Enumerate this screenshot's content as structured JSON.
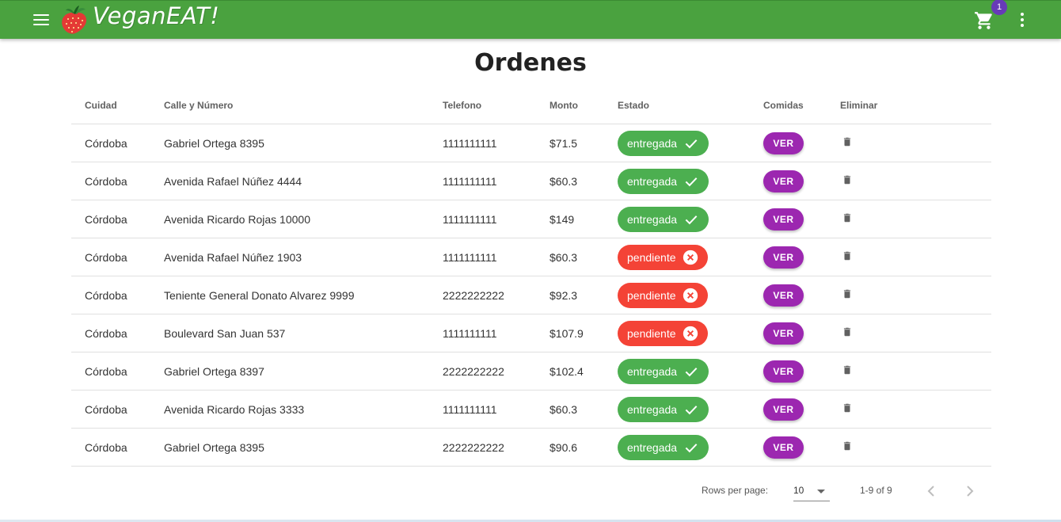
{
  "appbar": {
    "brand": "VeganEAT!",
    "cart_count": "1",
    "color": "#4aa23f"
  },
  "page": {
    "title": "Ordenes"
  },
  "table": {
    "headers": [
      "Cuidad",
      "Calle y Número",
      "Telefono",
      "Monto",
      "Estado",
      "Comidas",
      "Eliminar"
    ],
    "rows": [
      {
        "city": "Córdoba",
        "address": "Gabriel Ortega 8395",
        "phone": "1111111111",
        "amount": "$71.5",
        "status": "entregada",
        "status_type": "delivered",
        "meals": "VER"
      },
      {
        "city": "Córdoba",
        "address": "Avenida Rafael Núñez 4444",
        "phone": "1111111111",
        "amount": "$60.3",
        "status": "entregada",
        "status_type": "delivered",
        "meals": "VER"
      },
      {
        "city": "Córdoba",
        "address": "Avenida Ricardo Rojas 10000",
        "phone": "1111111111",
        "amount": "$149",
        "status": "entregada",
        "status_type": "delivered",
        "meals": "VER"
      },
      {
        "city": "Córdoba",
        "address": "Avenida Rafael Núñez 1903",
        "phone": "1111111111",
        "amount": "$60.3",
        "status": "pendiente",
        "status_type": "pending",
        "meals": "VER"
      },
      {
        "city": "Córdoba",
        "address": "Teniente General Donato Alvarez 9999",
        "phone": "2222222222",
        "amount": "$92.3",
        "status": "pendiente",
        "status_type": "pending",
        "meals": "VER"
      },
      {
        "city": "Córdoba",
        "address": "Boulevard San Juan 537",
        "phone": "1111111111",
        "amount": "$107.9",
        "status": "pendiente",
        "status_type": "pending",
        "meals": "VER"
      },
      {
        "city": "Córdoba",
        "address": "Gabriel Ortega 8397",
        "phone": "2222222222",
        "amount": "$102.4",
        "status": "entregada",
        "status_type": "delivered",
        "meals": "VER"
      },
      {
        "city": "Córdoba",
        "address": "Avenida Ricardo Rojas 3333",
        "phone": "1111111111",
        "amount": "$60.3",
        "status": "entregada",
        "status_type": "delivered",
        "meals": "VER"
      },
      {
        "city": "Córdoba",
        "address": "Gabriel Ortega 8395",
        "phone": "2222222222",
        "amount": "$90.6",
        "status": "entregada",
        "status_type": "delivered",
        "meals": "VER"
      }
    ]
  },
  "pagination": {
    "rows_label": "Rows per page:",
    "rows_value": "10",
    "range": "1-9 of 9"
  },
  "colors": {
    "delivered": "#4caf50",
    "pending": "#f44336",
    "ver_button": "#9c27b0",
    "badge": "#673ab7"
  },
  "icons": {
    "menu": "menu-icon",
    "logo": "strawberry-icon",
    "cart": "cart-icon",
    "more": "more-vert-icon",
    "delivered": "check-icon",
    "pending": "cancel-circle-icon",
    "delete": "trash-icon",
    "prev": "chevron-left-icon",
    "next": "chevron-right-icon"
  }
}
